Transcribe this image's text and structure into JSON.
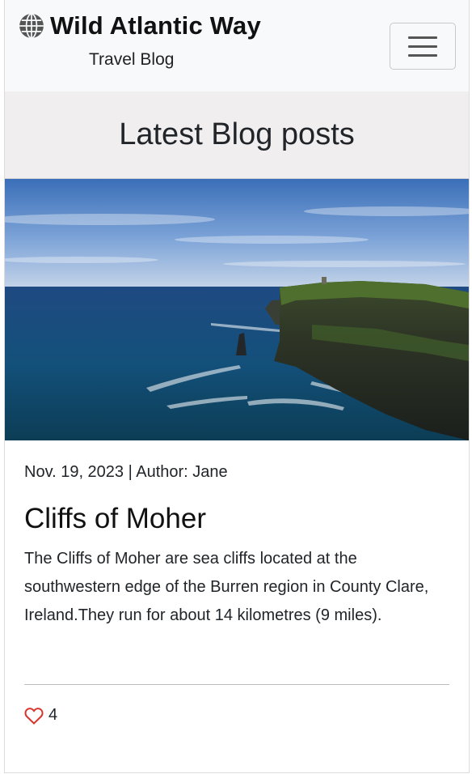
{
  "navbar": {
    "brand_title": "Wild Atlantic Way",
    "brand_subtitle": "Travel Blog",
    "icon": "globe-icon",
    "toggler_icon": "hamburger-menu-icon"
  },
  "section": {
    "heading": "Latest Blog posts"
  },
  "post": {
    "image_alt": "Cliffs of Moher photo",
    "meta": "Nov. 19, 2023 | Author: Jane",
    "title": "Cliffs of Moher",
    "excerpt": "The Cliffs of Moher are sea cliffs located at the southwestern edge of the Burren region in County Clare, Ireland.They run for about 14 kilometres (9 miles).",
    "likes": "4",
    "like_icon": "heart-icon"
  },
  "colors": {
    "navbar_bg": "#f8f9fa",
    "section_bg": "#f0eeee",
    "heart": "#d9342b"
  }
}
